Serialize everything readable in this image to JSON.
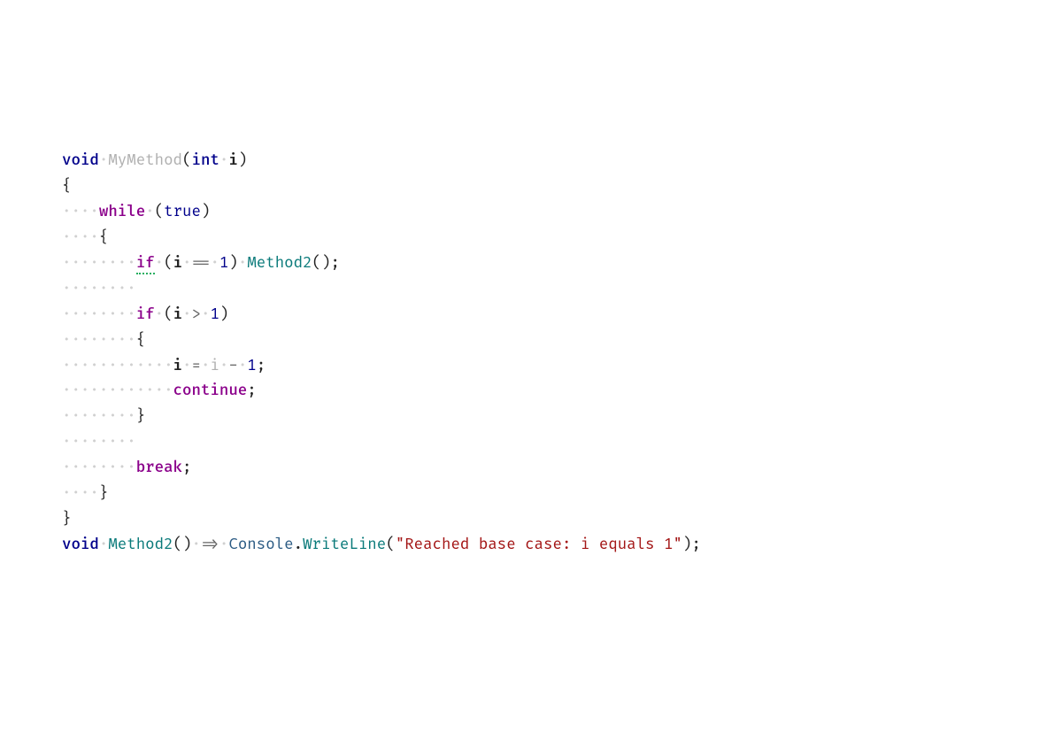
{
  "code": {
    "kw_void_1": "void",
    "mtd_mymethod": "MyMethod",
    "kw_int": "int",
    "param_i": "i",
    "brace_open_1": "{",
    "ctrl_while": "while",
    "bool_true": "true",
    "brace_open_2": "{",
    "ctrl_if_1": "if",
    "var_i_1": "i",
    "op_eqeq": "==",
    "num_1_a": "1",
    "mtd_method2_call": "Method2",
    "ctrl_if_2": "if",
    "var_i_2": "i",
    "op_gt": ">",
    "num_1_b": "1",
    "brace_open_3": "{",
    "var_i_assign_lhs": "i",
    "op_assign": "=",
    "var_i_assign_rhs": "i",
    "op_minus": "-",
    "num_1_c": "1",
    "ctrl_continue": "continue",
    "brace_close_3": "}",
    "ctrl_break": "break",
    "brace_close_2": "}",
    "brace_close_1": "}",
    "kw_void_2": "void",
    "mtd_method2_def": "Method2",
    "op_arrow": "=>",
    "cls_console": "Console",
    "mtd_writeline": "WriteLine",
    "str_msg": "\"Reached base case: i equals 1\"",
    "lparen": "(",
    "rparen": ")",
    "semi": ";",
    "dot": ".",
    "ws_dot": "·",
    "ws_4": "····",
    "ws_8": "········",
    "ws_12": "············"
  }
}
